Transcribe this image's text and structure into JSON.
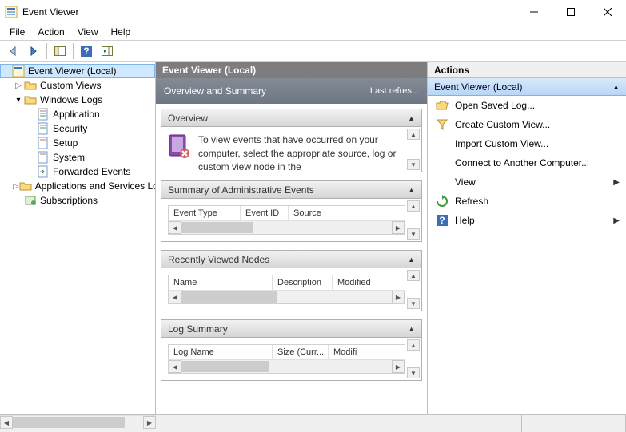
{
  "window": {
    "title": "Event Viewer"
  },
  "menu": {
    "file": "File",
    "action": "Action",
    "view": "View",
    "help": "Help"
  },
  "tree": {
    "root": "Event Viewer (Local)",
    "custom": "Custom Views",
    "winlogs": "Windows Logs",
    "app": "Application",
    "sec": "Security",
    "setup": "Setup",
    "system": "System",
    "fwd": "Forwarded Events",
    "appsvc": "Applications and Services Lo",
    "subs": "Subscriptions"
  },
  "center": {
    "title": "Event Viewer (Local)",
    "subtitle": "Overview and Summary",
    "refres": "Last refres...",
    "overview_head": "Overview",
    "overview_text": "To view events that have occurred on your computer, select the appropriate source, log or custom view node in the",
    "summary_head": "Summary of Administrative Events",
    "summary_cols": {
      "type": "Event Type",
      "id": "Event ID",
      "src": "Source"
    },
    "recent_head": "Recently Viewed Nodes",
    "recent_cols": {
      "name": "Name",
      "desc": "Description",
      "mod": "Modified"
    },
    "logsum_head": "Log Summary",
    "logsum_cols": {
      "name": "Log Name",
      "size": "Size (Curr...",
      "mod": "Modifi"
    }
  },
  "actions": {
    "head": "Actions",
    "group": "Event Viewer (Local)",
    "open": "Open Saved Log...",
    "create": "Create Custom View...",
    "import": "Import Custom View...",
    "connect": "Connect to Another Computer...",
    "view": "View",
    "refresh": "Refresh",
    "help": "Help"
  }
}
